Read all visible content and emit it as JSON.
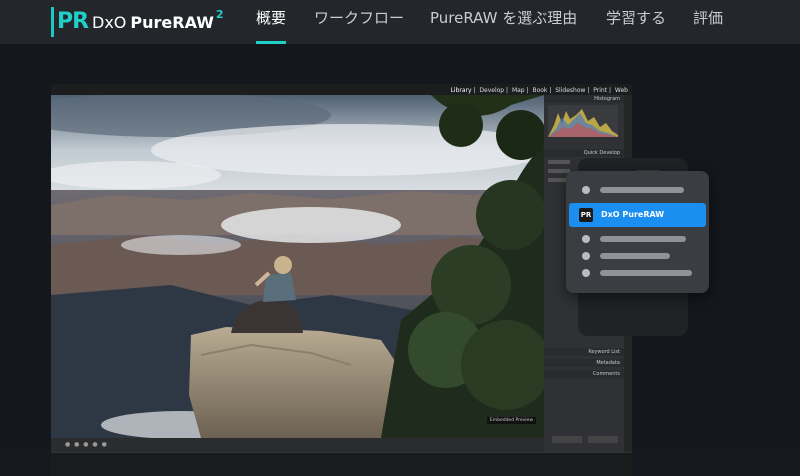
{
  "brand": {
    "badge": "PR",
    "dxo": "DxO",
    "product": "PureRAW",
    "version": "2"
  },
  "nav": {
    "items": [
      {
        "label": "概要",
        "active": true
      },
      {
        "label": "ワークフロー",
        "active": false
      },
      {
        "label": "PureRAW を選ぶ理由",
        "active": false
      },
      {
        "label": "学習する",
        "active": false
      },
      {
        "label": "評価",
        "active": false
      }
    ]
  },
  "app": {
    "modules": [
      "Library",
      "Develop",
      "Map",
      "Book",
      "Slideshow",
      "Print",
      "Web"
    ],
    "panel_sections": [
      "Histogram",
      "Quick Develop",
      "Keyword List",
      "Metadata",
      "Comments"
    ],
    "embedded_preview_label": "Embedded Preview"
  },
  "popup_menu": {
    "highlighted_item": {
      "icon": "PR",
      "label": "DxO PureRAW"
    }
  },
  "colors": {
    "accent": "#1fd0c8",
    "nav_bg": "#23262b",
    "page_bg": "#14171c",
    "menu_highlight": "#1b8ff0"
  }
}
